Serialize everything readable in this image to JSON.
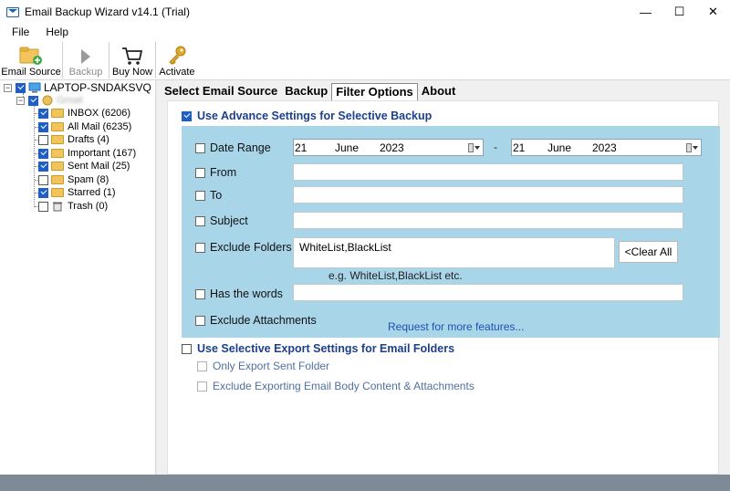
{
  "window": {
    "title": "Email Backup Wizard v14.1 (Trial)",
    "minimize": "—",
    "maximize": "☐",
    "close": "✕"
  },
  "menu": [
    "File",
    "Help"
  ],
  "toolbar": {
    "email_source": "Email Source",
    "backup": "Backup",
    "buy_now": "Buy Now",
    "activate": "Activate"
  },
  "tree": {
    "root": "LAPTOP-SNDAKSVQ",
    "account": "Gmail",
    "folders": [
      {
        "label": "INBOX (6206)",
        "checked": true
      },
      {
        "label": "All Mail (6235)",
        "checked": true
      },
      {
        "label": "Drafts (4)",
        "checked": false
      },
      {
        "label": "Important (167)",
        "checked": true
      },
      {
        "label": "Sent Mail (25)",
        "checked": true
      },
      {
        "label": "Spam (8)",
        "checked": false
      },
      {
        "label": "Starred (1)",
        "checked": true
      },
      {
        "label": "Trash (0)",
        "checked": false
      }
    ]
  },
  "tabs": [
    "Select Email Source",
    "Backup",
    "Filter Options",
    "About"
  ],
  "filter": {
    "use_advance": "Use Advance Settings for Selective Backup",
    "date_range": "Date Range",
    "date_from": {
      "day": "21",
      "month": "June",
      "year": "2023"
    },
    "date_sep": "-",
    "date_to": {
      "day": "21",
      "month": "June",
      "year": "2023"
    },
    "from": "From",
    "to": "To",
    "subject": "Subject",
    "exclude_folders": "Exclude Folders",
    "exclude_folders_value": "WhiteList,BlackList",
    "clear_all": "<Clear All",
    "example": "e.g. WhiteList,BlackList etc.",
    "has_words": "Has the words",
    "exclude_attachments": "Exclude Attachments",
    "request_link": "Request for more features...",
    "use_selective": "Use Selective Export Settings for Email Folders",
    "only_sent": "Only Export Sent Folder",
    "exclude_body": "Exclude Exporting Email Body Content & Attachments"
  },
  "colors": {
    "accent": "#1f5fc4",
    "advance_box": "#a9d5e9",
    "heading": "#1d3f8c",
    "link": "#1f50b4",
    "statusbar": "#7e8a96"
  }
}
